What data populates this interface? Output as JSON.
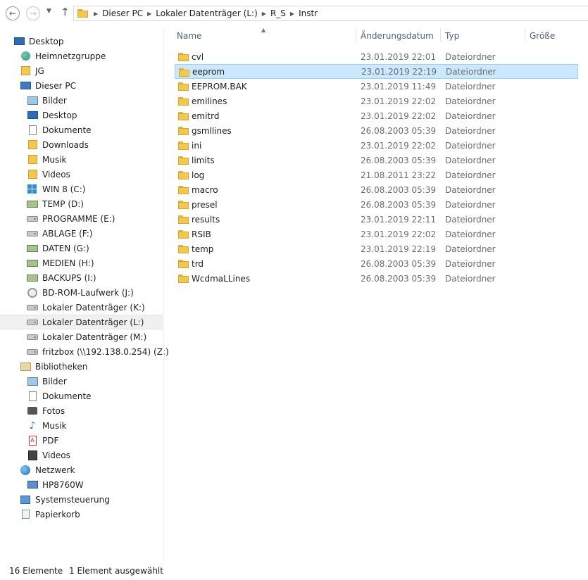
{
  "address": {
    "crumbs": [
      "Dieser PC",
      "Lokaler Datenträger (L:)",
      "R_S",
      "Instr"
    ]
  },
  "nav": [
    {
      "label": "Desktop",
      "level": 0,
      "icon": "desktop-icon"
    },
    {
      "label": "Heimnetzgruppe",
      "level": 1,
      "icon": "homegroup-icon"
    },
    {
      "label": "JG",
      "level": 1,
      "icon": "user-folder-icon"
    },
    {
      "label": "Dieser PC",
      "level": 1,
      "icon": "computer-icon"
    },
    {
      "label": "Bilder",
      "level": 2,
      "icon": "pictures-folder-icon"
    },
    {
      "label": "Desktop",
      "level": 2,
      "icon": "desktop-folder-icon"
    },
    {
      "label": "Dokumente",
      "level": 2,
      "icon": "documents-folder-icon"
    },
    {
      "label": "Downloads",
      "level": 2,
      "icon": "downloads-folder-icon"
    },
    {
      "label": "Musik",
      "level": 2,
      "icon": "music-folder-icon"
    },
    {
      "label": "Videos",
      "level": 2,
      "icon": "videos-folder-icon"
    },
    {
      "label": "WIN 8 (C:)",
      "level": 2,
      "icon": "windows-drive-icon"
    },
    {
      "label": "TEMP (D:)",
      "level": 2,
      "icon": "hard-drive-icon"
    },
    {
      "label": "PROGRAMME (E:)",
      "level": 2,
      "icon": "drive-icon"
    },
    {
      "label": "ABLAGE (F:)",
      "level": 2,
      "icon": "drive-icon"
    },
    {
      "label": "DATEN (G:)",
      "level": 2,
      "icon": "hard-drive-icon"
    },
    {
      "label": "MEDIEN (H:)",
      "level": 2,
      "icon": "hard-drive-icon"
    },
    {
      "label": "BACKUPS (I:)",
      "level": 2,
      "icon": "hard-drive-icon"
    },
    {
      "label": "BD-ROM-Laufwerk (J:)",
      "level": 2,
      "icon": "optical-drive-icon"
    },
    {
      "label": "Lokaler Datenträger (K:)",
      "level": 2,
      "icon": "drive-icon"
    },
    {
      "label": "Lokaler Datenträger (L:)",
      "level": 2,
      "icon": "drive-icon",
      "selected": true
    },
    {
      "label": "Lokaler Datenträger (M:)",
      "level": 2,
      "icon": "drive-icon"
    },
    {
      "label": "fritzbox (\\\\192.138.0.254) (Z:)",
      "level": 2,
      "icon": "network-drive-icon"
    },
    {
      "label": "Bibliotheken",
      "level": 1,
      "icon": "libraries-icon"
    },
    {
      "label": "Bilder",
      "level": 2,
      "icon": "pictures-library-icon"
    },
    {
      "label": "Dokumente",
      "level": 2,
      "icon": "documents-library-icon"
    },
    {
      "label": "Fotos",
      "level": 2,
      "icon": "camera-icon"
    },
    {
      "label": "Musik",
      "level": 2,
      "icon": "music-note-icon"
    },
    {
      "label": "PDF",
      "level": 2,
      "icon": "pdf-icon"
    },
    {
      "label": "Videos",
      "level": 2,
      "icon": "video-library-icon"
    },
    {
      "label": "Netzwerk",
      "level": 1,
      "icon": "network-icon"
    },
    {
      "label": "HP8760W",
      "level": 2,
      "icon": "network-computer-icon"
    },
    {
      "label": "Systemsteuerung",
      "level": 1,
      "icon": "control-panel-icon"
    },
    {
      "label": "Papierkorb",
      "level": 1,
      "icon": "recycle-bin-icon"
    }
  ],
  "columns": [
    "Name",
    "Änderungsdatum",
    "Typ",
    "Größe"
  ],
  "files": [
    {
      "name": "cvl",
      "date": "23.01.2019 22:01",
      "type": "Dateiordner"
    },
    {
      "name": "eeprom",
      "date": "23.01.2019 22:19",
      "type": "Dateiordner",
      "selected": true
    },
    {
      "name": "EEPROM.BAK",
      "date": "23.01.2019 11:49",
      "type": "Dateiordner"
    },
    {
      "name": "emilines",
      "date": "23.01.2019 22:02",
      "type": "Dateiordner"
    },
    {
      "name": "emitrd",
      "date": "23.01.2019 22:02",
      "type": "Dateiordner"
    },
    {
      "name": "gsmllines",
      "date": "26.08.2003 05:39",
      "type": "Dateiordner"
    },
    {
      "name": "ini",
      "date": "23.01.2019 22:02",
      "type": "Dateiordner"
    },
    {
      "name": "limits",
      "date": "26.08.2003 05:39",
      "type": "Dateiordner"
    },
    {
      "name": "log",
      "date": "21.08.2011 23:22",
      "type": "Dateiordner"
    },
    {
      "name": "macro",
      "date": "26.08.2003 05:39",
      "type": "Dateiordner"
    },
    {
      "name": "presel",
      "date": "26.08.2003 05:39",
      "type": "Dateiordner"
    },
    {
      "name": "results",
      "date": "23.01.2019 22:11",
      "type": "Dateiordner"
    },
    {
      "name": "RSIB",
      "date": "23.01.2019 22:02",
      "type": "Dateiordner"
    },
    {
      "name": "temp",
      "date": "23.01.2019 22:19",
      "type": "Dateiordner"
    },
    {
      "name": "trd",
      "date": "26.08.2003 05:39",
      "type": "Dateiordner"
    },
    {
      "name": "WcdmaLLines",
      "date": "26.08.2003 05:39",
      "type": "Dateiordner"
    }
  ],
  "status": {
    "count": "16 Elemente",
    "selection": "1 Element ausgewählt"
  }
}
